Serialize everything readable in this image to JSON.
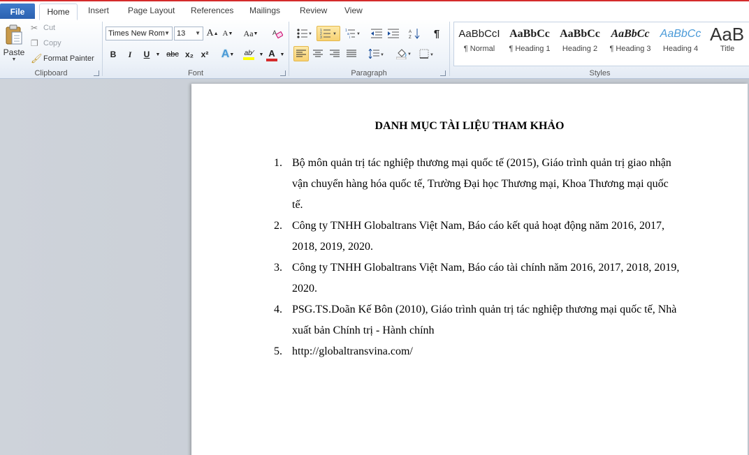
{
  "tabs": [
    {
      "label": "File"
    },
    {
      "label": "Home"
    },
    {
      "label": "Insert"
    },
    {
      "label": "Page Layout"
    },
    {
      "label": "References"
    },
    {
      "label": "Mailings"
    },
    {
      "label": "Review"
    },
    {
      "label": "View"
    }
  ],
  "clipboard": {
    "paste": "Paste",
    "cut": "Cut",
    "copy": "Copy",
    "format_painter": "Format Painter",
    "group_label": "Clipboard"
  },
  "font": {
    "font_name": "Times New Rom",
    "font_size": "13",
    "change_case": "Aa",
    "bold": "B",
    "italic": "I",
    "underline": "U",
    "strike": "abc",
    "subscript": "x₂",
    "superscript": "x²",
    "group_label": "Font"
  },
  "paragraph": {
    "group_label": "Paragraph"
  },
  "styles": {
    "group_label": "Styles",
    "items": [
      {
        "sample": "AaBbCcI",
        "name": "¶ Normal"
      },
      {
        "sample": "AaBbCc",
        "name": "¶ Heading 1"
      },
      {
        "sample": "AaBbCc",
        "name": "Heading 2"
      },
      {
        "sample": "AaBbCc",
        "name": "¶ Heading 3"
      },
      {
        "sample": "AaBbCc",
        "name": "Heading 4"
      },
      {
        "sample": "AaB",
        "name": "Title"
      }
    ]
  },
  "document": {
    "title": "DANH MỤC TÀI LIỆU THAM KHẢO",
    "references": [
      {
        "number": "1.",
        "text": "Bộ môn quản trị tác nghiệp thương mại quốc tế (2015), Giáo trình quản trị giao nhận vận chuyển hàng hóa quốc tế, Trường Đại học Thương mại, Khoa Thương mại quốc tế."
      },
      {
        "number": "2.",
        "text": "Công ty TNHH Globaltrans Việt Nam, Báo cáo kết quả hoạt động năm 2016, 2017, 2018, 2019, 2020."
      },
      {
        "number": "3.",
        "text": "Công ty TNHH Globaltrans Việt Nam, Báo cáo tài chính năm 2016, 2017, 2018, 2019, 2020."
      },
      {
        "number": "4.",
        "text": "PSG.TS.Doãn  Kế Bôn (2010), Giáo trình quản trị tác nghiệp thương mại quốc tế, Nhà xuất bản Chính trị - Hành chính"
      },
      {
        "number": "5.",
        "text": "http://globaltransvina.com/"
      }
    ]
  },
  "colors": {
    "accent": "#2a5fae",
    "highlight": "#f8d273",
    "font_color": "#d42b2b",
    "text_highlight": "#ffff00"
  }
}
